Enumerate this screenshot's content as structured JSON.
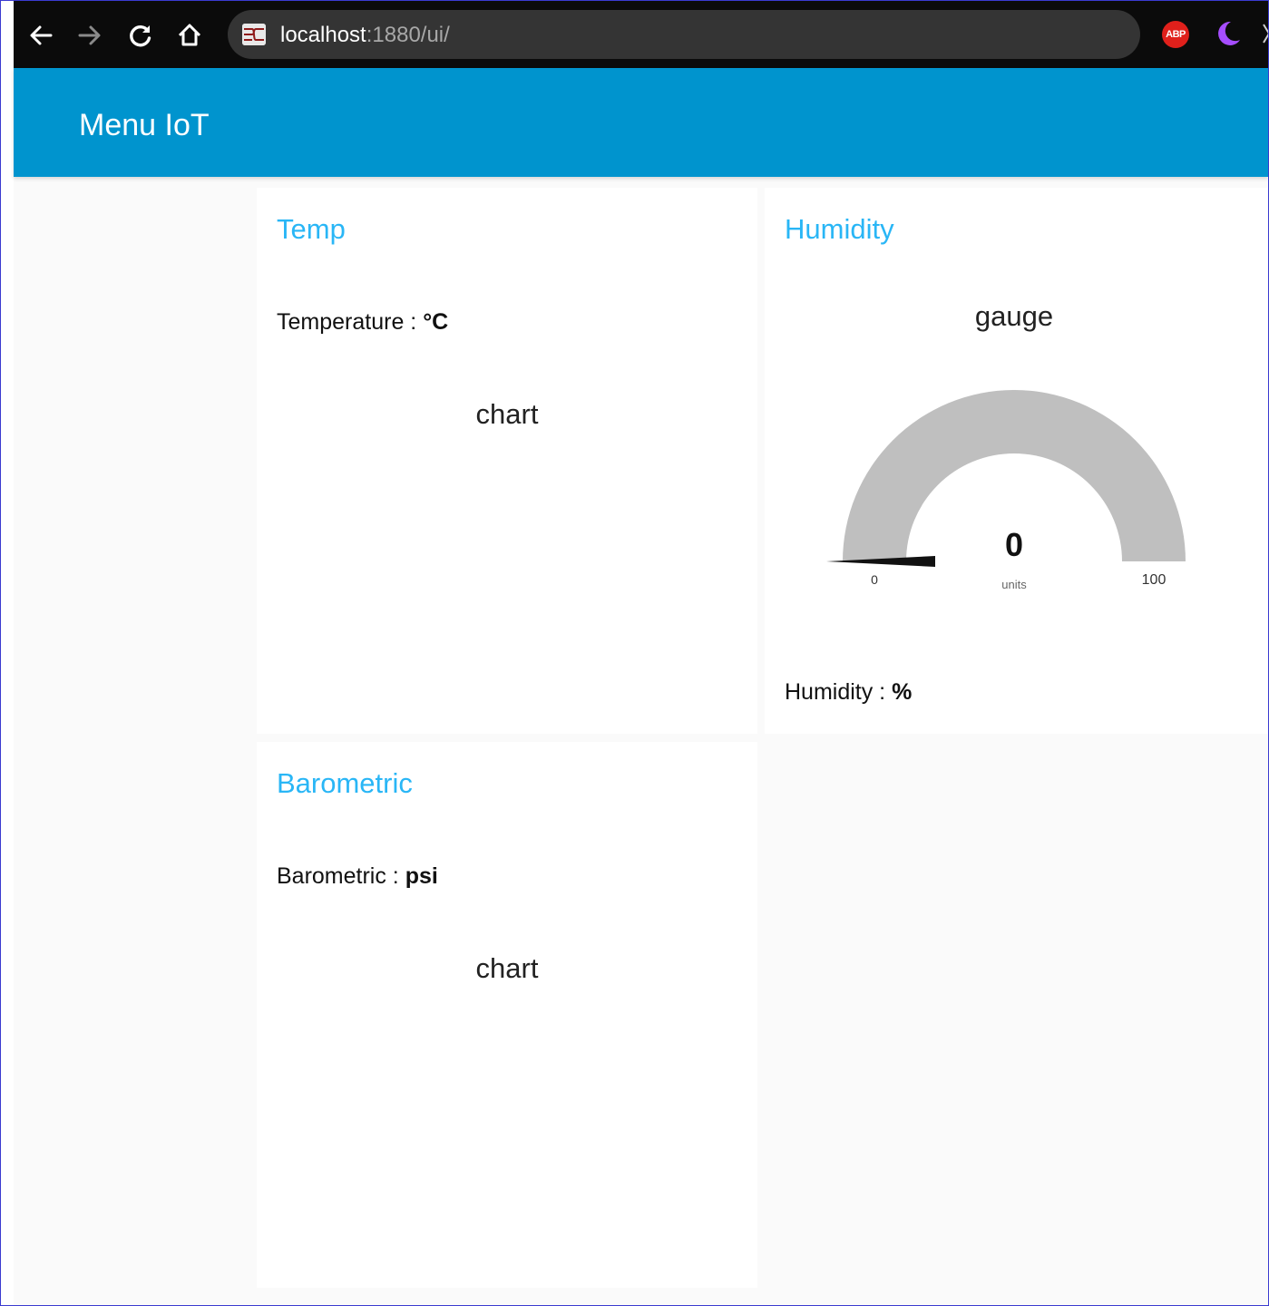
{
  "browser": {
    "url_host": "localhost",
    "url_rest": ":1880/ui/",
    "extensions": {
      "abp_label": "ABP"
    },
    "icons": [
      "back-icon",
      "forward-icon",
      "reload-icon",
      "home-icon"
    ]
  },
  "header": {
    "title": "Menu IoT",
    "color": "#0094ce"
  },
  "cards": {
    "temp": {
      "title": "Temp",
      "text_label": "Temperature : ",
      "text_value": "°C",
      "chart_label": "chart"
    },
    "humidity": {
      "title": "Humidity",
      "gauge_title": "gauge",
      "gauge_value": "0",
      "gauge_units": "units",
      "gauge_min": "0",
      "gauge_max": "100",
      "gauge_level": 0,
      "text_label": "Humidity : ",
      "text_value": "%"
    },
    "barometric": {
      "title": "Barometric",
      "text_label": "Barometric : ",
      "text_value": "psi",
      "chart_label": "chart"
    }
  },
  "colors": {
    "accent": "#29b6f6",
    "gauge_track": "#bfbfbf"
  }
}
